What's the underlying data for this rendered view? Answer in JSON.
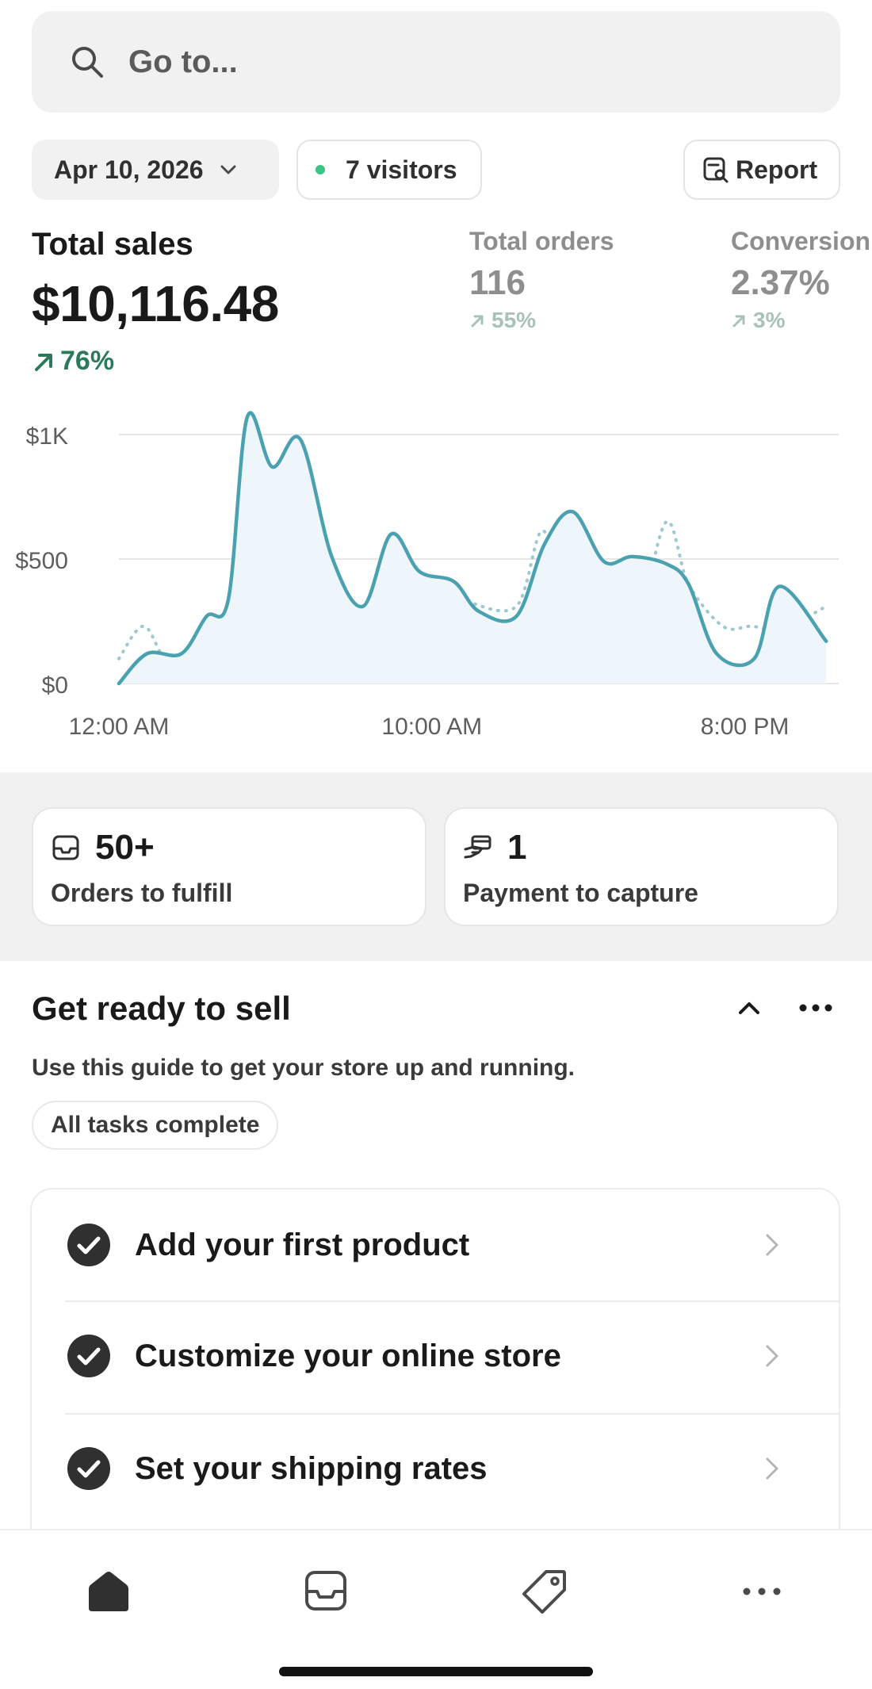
{
  "search": {
    "placeholder": "Go to..."
  },
  "filters": {
    "date": "Apr 10, 2026",
    "visitors": "7 visitors",
    "report": "Report"
  },
  "metrics": {
    "total_sales": {
      "title": "Total sales",
      "value": "$10,116.48",
      "delta": "76%"
    },
    "total_orders": {
      "title": "Total orders",
      "value": "116",
      "delta": "55%"
    },
    "conversion": {
      "title": "Conversion",
      "value": "2.37%",
      "delta": "3%"
    }
  },
  "chart_data": {
    "type": "line",
    "ylim": [
      0,
      1000
    ],
    "yticks": [
      {
        "value": 0,
        "label": "$0"
      },
      {
        "value": 500,
        "label": "$500"
      },
      {
        "value": 1000,
        "label": "$1K"
      }
    ],
    "xlim": [
      0,
      23
    ],
    "xticks": [
      {
        "value": 0,
        "label": "12:00 AM"
      },
      {
        "value": 10,
        "label": "10:00 AM"
      },
      {
        "value": 20,
        "label": "8:00 PM"
      }
    ],
    "series": [
      {
        "style": "solid",
        "color": "#4aa1b0",
        "points": [
          [
            0,
            0
          ],
          [
            0.9,
            120
          ],
          [
            2,
            120
          ],
          [
            2.8,
            270
          ],
          [
            3.5,
            340
          ],
          [
            4.1,
            1070
          ],
          [
            4.9,
            870
          ],
          [
            5.8,
            980
          ],
          [
            6.8,
            510
          ],
          [
            7.8,
            310
          ],
          [
            8.7,
            600
          ],
          [
            9.6,
            450
          ],
          [
            10.7,
            410
          ],
          [
            11.5,
            290
          ],
          [
            12.7,
            270
          ],
          [
            13.6,
            560
          ],
          [
            14.5,
            690
          ],
          [
            15.5,
            490
          ],
          [
            16.4,
            510
          ],
          [
            17.5,
            480
          ],
          [
            18.2,
            400
          ],
          [
            19.1,
            120
          ],
          [
            20.3,
            100
          ],
          [
            21.1,
            390
          ],
          [
            22.6,
            170
          ]
        ]
      },
      {
        "style": "dotted",
        "color": "#9ec8cf",
        "points": [
          [
            0,
            100
          ],
          [
            0.8,
            230
          ],
          [
            1.6,
            80
          ],
          [
            3.1,
            10
          ],
          [
            3.8,
            100
          ],
          [
            5.2,
            150
          ],
          [
            6.4,
            330
          ],
          [
            7.2,
            90
          ],
          [
            8.4,
            170
          ],
          [
            9.5,
            40
          ],
          [
            10.4,
            370
          ],
          [
            11.1,
            330
          ],
          [
            12.7,
            310
          ],
          [
            13.6,
            610
          ],
          [
            14.5,
            40
          ],
          [
            15.5,
            280
          ],
          [
            16.6,
            290
          ],
          [
            17.5,
            650
          ],
          [
            18.2,
            400
          ],
          [
            19.3,
            230
          ],
          [
            20.2,
            230
          ],
          [
            21.2,
            220
          ],
          [
            22.6,
            310
          ]
        ]
      }
    ]
  },
  "cards": [
    {
      "value": "50+",
      "label": "Orders to fulfill",
      "icon": "inbox-icon"
    },
    {
      "value": "1",
      "label": "Payment to capture",
      "icon": "hand-card-icon"
    }
  ],
  "guide": {
    "title": "Get ready to sell",
    "description": "Use this guide to get your store up and running.",
    "badge": "All tasks complete",
    "tasks": [
      {
        "label": "Add your first product"
      },
      {
        "label": "Customize your online store"
      },
      {
        "label": "Set your shipping rates"
      }
    ]
  },
  "nav": [
    "home-icon",
    "orders-icon",
    "products-icon",
    "more-icon"
  ]
}
